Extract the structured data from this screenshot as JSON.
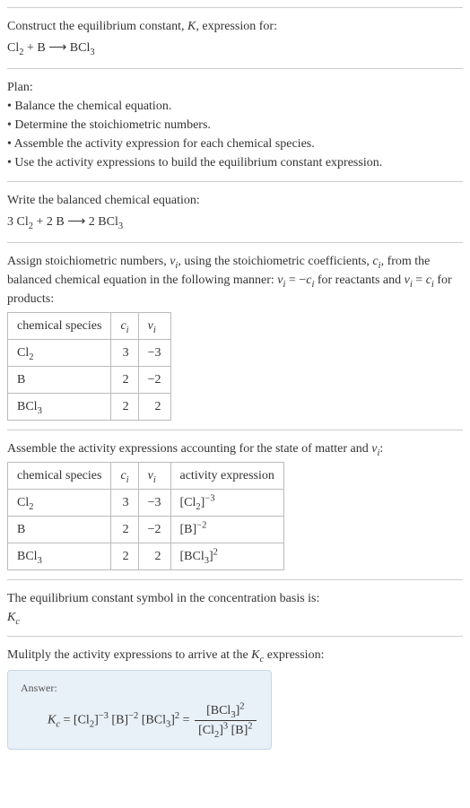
{
  "intro": {
    "line1": "Construct the equilibrium constant, ",
    "K": "K",
    "line1b": ", expression for:",
    "eq_lhs": "Cl",
    "eq_sub1": "2",
    "eq_plus": " + B ",
    "eq_arrow": "⟶",
    "eq_rhs": " BCl",
    "eq_sub2": "3"
  },
  "plan": {
    "title": "Plan:",
    "b1": "• Balance the chemical equation.",
    "b2": "• Determine the stoichiometric numbers.",
    "b3": "• Assemble the activity expression for each chemical species.",
    "b4": "• Use the activity expressions to build the equilibrium constant expression."
  },
  "balanced": {
    "title": "Write the balanced chemical equation:",
    "c1": "3 Cl",
    "s1": "2",
    "c2": " + 2 B ",
    "arrow": "⟶",
    "c3": " 2 BCl",
    "s3": "3"
  },
  "stoich": {
    "p1": "Assign stoichiometric numbers, ",
    "nu": "ν",
    "i": "i",
    "p2": ", using the stoichiometric coefficients, ",
    "c": "c",
    "p3": ", from the balanced chemical equation in the following manner: ",
    "rel1a": "ν",
    "rel1b": " = −",
    "rel1c": "c",
    "p4": " for reactants and ",
    "rel2a": "ν",
    "rel2b": " = ",
    "rel2c": "c",
    "p5": " for products:",
    "h1": "chemical species",
    "h2": "c",
    "h3": "ν",
    "rows": [
      {
        "sp": "Cl",
        "sub": "2",
        "c": "3",
        "nu": "−3"
      },
      {
        "sp": "B",
        "sub": "",
        "c": "2",
        "nu": "−2"
      },
      {
        "sp": "BCl",
        "sub": "3",
        "c": "2",
        "nu": "2"
      }
    ]
  },
  "activity": {
    "title": "Assemble the activity expressions accounting for the state of matter and ",
    "nu": "ν",
    "i": "i",
    "colon": ":",
    "h1": "chemical species",
    "h2": "c",
    "h3": "ν",
    "h4": "activity expression",
    "rows": [
      {
        "sp": "Cl",
        "sub": "2",
        "c": "3",
        "nu": "−3",
        "base": "[Cl",
        "bsub": "2",
        "close": "]",
        "exp": "−3"
      },
      {
        "sp": "B",
        "sub": "",
        "c": "2",
        "nu": "−2",
        "base": "[B",
        "bsub": "",
        "close": "]",
        "exp": "−2"
      },
      {
        "sp": "BCl",
        "sub": "3",
        "c": "2",
        "nu": "2",
        "base": "[BCl",
        "bsub": "3",
        "close": "]",
        "exp": "2"
      }
    ]
  },
  "symbol": {
    "title": "The equilibrium constant symbol in the concentration basis is:",
    "K": "K",
    "c": "c"
  },
  "final": {
    "title": "Mulitply the activity expressions to arrive at the ",
    "K": "K",
    "c": "c",
    "title2": " expression:",
    "answer": "Answer:",
    "Kc": "K",
    "Kcsub": "c",
    "eq": " = [Cl",
    "s1": "2",
    "b1": "]",
    "e1": "−3",
    "sp1": " [B]",
    "e2": "−2",
    "sp2": " [BCl",
    "s3": "3",
    "b3": "]",
    "e3": "2",
    "eq2": " = ",
    "top": "[BCl",
    "tsub": "3",
    "tclose": "]",
    "texp": "2",
    "bot1": "[Cl",
    "bsub1": "2",
    "bclose1": "]",
    "bexp1": "3",
    "bot2": " [B]",
    "bexp2": "2"
  }
}
